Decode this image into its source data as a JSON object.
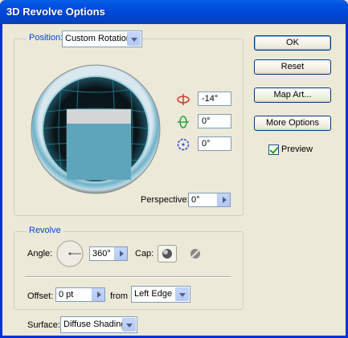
{
  "window": {
    "title": "3D Revolve Options"
  },
  "position": {
    "label": "Position:",
    "preset": "Custom Rotation",
    "rotation_x": "-14°",
    "rotation_y": "0°",
    "rotation_z": "0°",
    "perspective_label": "Perspective:",
    "perspective": "0°"
  },
  "revolve": {
    "title": "Revolve",
    "angle_label": "Angle:",
    "angle": "360°",
    "cap_label": "Cap:",
    "offset_label": "Offset:",
    "offset": "0 pt",
    "from_label": "from",
    "from_value": "Left Edge"
  },
  "surface": {
    "label": "Surface:",
    "value": "Diffuse Shading"
  },
  "buttons": {
    "ok": "OK",
    "reset": "Reset",
    "map_art": "Map Art...",
    "more_options": "More Options"
  },
  "preview": {
    "label": "Preview",
    "checked": true
  }
}
